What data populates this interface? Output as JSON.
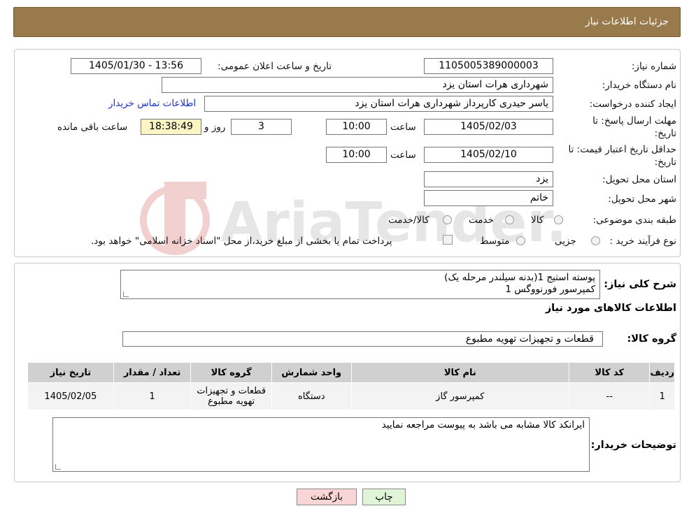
{
  "header": {
    "title": "جزئیات اطلاعات نیاز"
  },
  "fields": {
    "need_number_label": "شماره نیاز:",
    "need_number": "1105005389000003",
    "announce_label": "تاریخ و ساعت اعلان عمومی:",
    "announce_value": "1405/01/30 - 13:56",
    "buyer_org_label": "نام دستگاه خریدار:",
    "buyer_org": "شهرداری هرات استان یزد",
    "creator_label": "ایجاد کننده درخواست:",
    "creator": "یاسر حیدری کارپرداز شهرداری هرات استان یزد",
    "contact_link": "اطلاعات تماس خریدار",
    "reply_deadline_label_1": "مهلت ارسال پاسخ: تا",
    "reply_deadline_label_2": "تاریخ:",
    "reply_date": "1405/02/03",
    "time_label": "ساعت",
    "reply_time": "10:00",
    "days_value": "3",
    "days_label": "روز و",
    "remaining_time": "18:38:49",
    "remaining_label": "ساعت باقی مانده",
    "validity_label_1": "حداقل تاریخ اعتبار قیمت: تا",
    "validity_label_2": "تاریخ:",
    "validity_date": "1405/02/10",
    "validity_time": "10:00",
    "province_label": "استان محل تحویل:",
    "province": "یزد",
    "city_label": "شهر محل تحویل:",
    "city": "خاتم",
    "category_label": "طبقه بندی موضوعی:",
    "category_options": [
      "کالا",
      "خدمت",
      "کالا/خدمت"
    ],
    "purchase_type_label": "نوع فرآیند خرید :",
    "purchase_options": [
      "جزیی",
      "متوسط"
    ],
    "purchase_note": "پرداخت تمام یا بخشی از مبلغ خرید،از محل \"اسناد خزانه اسلامی\" خواهد بود."
  },
  "description": {
    "label": "شرح کلی نیاز:",
    "line1": "پوسته استیج 1(بدنه سیلندر مرحله یک)",
    "line2": "کمپرسور فورنووگس 1"
  },
  "goods": {
    "title": "اطلاعات کالاهای مورد نیاز",
    "group_label": "گروه کالا:",
    "group_value": "قطعات و تجهیزات تهویه مطبوع",
    "columns": [
      "ردیف",
      "کد کالا",
      "نام کالا",
      "واحد شمارش",
      "گروه کالا",
      "تعداد / مقدار",
      "تاریخ نیاز"
    ],
    "rows": [
      [
        "1",
        "--",
        "کمپرسور گاز",
        "دستگاه",
        "قطعات و تجهیزات تهویه مطبوع",
        "1",
        "1405/02/05"
      ]
    ]
  },
  "buyer_notes": {
    "label": "توضیحات خریدار:",
    "text": "ایرانکد کالا مشابه می باشد به پیوست مراجعه نمایید"
  },
  "buttons": {
    "print": "چاپ",
    "back": "بازگشت"
  },
  "watermark_text": "AriaTender.neT",
  "colors": {
    "header": "#997a4c",
    "link": "#1a33cc",
    "back_button": "#f9d5d5",
    "print_button": "#e0f5d8"
  }
}
